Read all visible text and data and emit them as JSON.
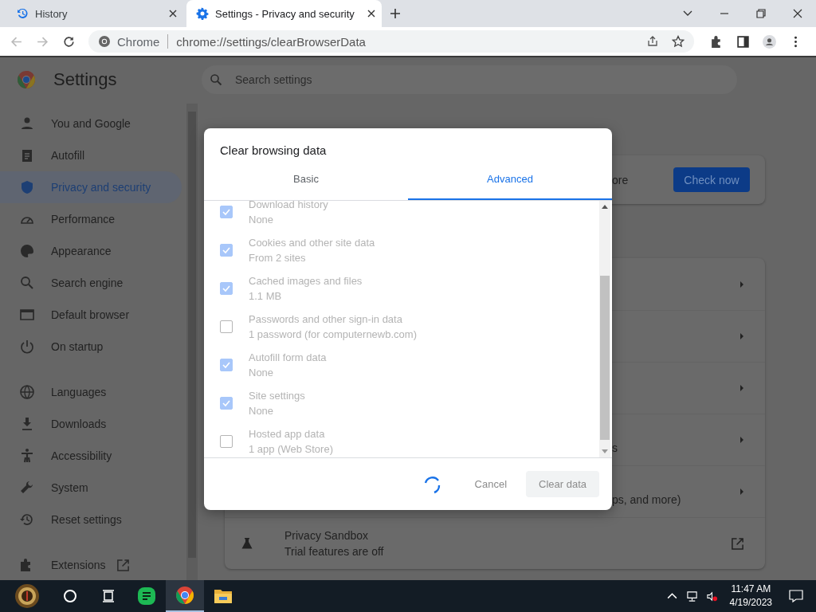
{
  "browser": {
    "tabs": [
      {
        "title": "History",
        "selected": false
      },
      {
        "title": "Settings - Privacy and security",
        "selected": true
      }
    ],
    "omnibox": {
      "site_label": "Chrome",
      "url": "chrome://settings/clearBrowserData"
    }
  },
  "settings": {
    "title": "Settings",
    "search": {
      "placeholder": "Search settings"
    },
    "nav_groups": [
      [
        {
          "label": "You and Google",
          "selected": false
        },
        {
          "label": "Autofill",
          "selected": false
        },
        {
          "label": "Privacy and security",
          "selected": true
        },
        {
          "label": "Performance",
          "selected": false
        },
        {
          "label": "Appearance",
          "selected": false
        },
        {
          "label": "Search engine",
          "selected": false
        },
        {
          "label": "Default browser",
          "selected": false
        },
        {
          "label": "On startup",
          "selected": false
        }
      ],
      [
        {
          "label": "Languages",
          "selected": false
        },
        {
          "label": "Downloads",
          "selected": false
        },
        {
          "label": "Accessibility",
          "selected": false
        },
        {
          "label": "System",
          "selected": false
        },
        {
          "label": "Reset settings",
          "selected": false
        }
      ],
      [
        {
          "label": "Extensions",
          "selected": false,
          "external": true
        }
      ]
    ],
    "safety_card": {
      "text_tail": "ore",
      "button": "Check now"
    },
    "privacy_rows": [
      {
        "kind": "arrow"
      },
      {
        "kind": "arrow"
      },
      {
        "kind": "arrow"
      },
      {
        "kind": "arrow",
        "tail": "s"
      },
      {
        "kind": "arrow",
        "tail": "ps, and more)"
      },
      {
        "kind": "external",
        "title": "Privacy Sandbox",
        "subtitle": "Trial features are off"
      }
    ]
  },
  "dialog": {
    "title": "Clear browsing data",
    "loading": true,
    "tabs": [
      {
        "label": "Basic",
        "selected": false
      },
      {
        "label": "Advanced",
        "selected": true
      }
    ],
    "items": [
      {
        "label": "Download history",
        "detail": "None",
        "checked": true
      },
      {
        "label": "Cookies and other site data",
        "detail": "From 2 sites",
        "checked": true
      },
      {
        "label": "Cached images and files",
        "detail": "1.1 MB",
        "checked": true
      },
      {
        "label": "Passwords and other sign-in data",
        "detail": "1 password (for computernewb.com)",
        "checked": false
      },
      {
        "label": "Autofill form data",
        "detail": "None",
        "checked": true
      },
      {
        "label": "Site settings",
        "detail": "None",
        "checked": true
      },
      {
        "label": "Hosted app data",
        "detail": "1 app (Web Store)",
        "checked": false
      }
    ],
    "cancel": "Cancel",
    "confirm": "Clear data"
  },
  "taskbar": {
    "apps": [
      {
        "kind": "notes",
        "active": false
      },
      {
        "kind": "chrome",
        "active": true
      },
      {
        "kind": "folder",
        "active": false
      }
    ],
    "time": "11:47 AM",
    "date": "4/19/2023"
  }
}
